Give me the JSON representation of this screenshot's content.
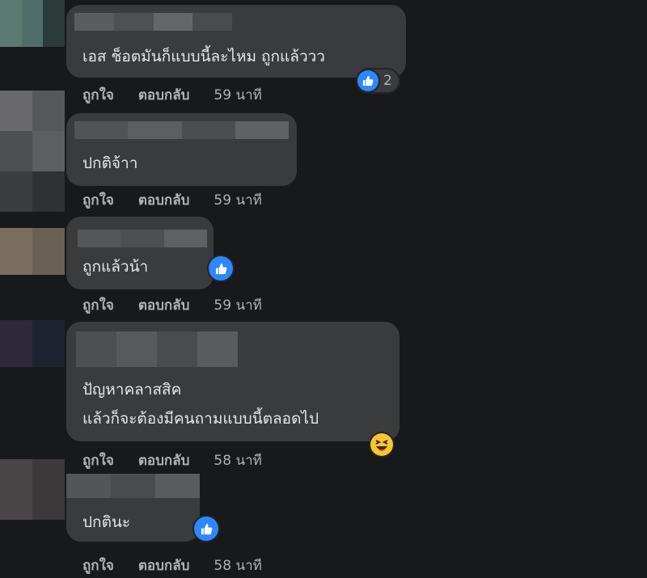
{
  "comments": [
    {
      "text_lines": [
        "เอส ช็อตมันก็แบบนี้ละไหม ถูกแล้ววว"
      ],
      "actions": {
        "like": "ถูกใจ",
        "reply": "ตอบกลับ",
        "time": "59 นาที"
      },
      "reaction": {
        "icon": "like-icon",
        "count": "2"
      }
    },
    {
      "text_lines": [
        "ปกติจ้าา"
      ],
      "actions": {
        "like": "ถูกใจ",
        "reply": "ตอบกลับ",
        "time": "59 นาที"
      },
      "reaction": null
    },
    {
      "text_lines": [
        "ถูกแล้วน้า"
      ],
      "actions": {
        "like": "ถูกใจ",
        "reply": "ตอบกลับ",
        "time": "59 นาที"
      },
      "reaction": {
        "icon": "like-icon",
        "count": ""
      }
    },
    {
      "text_lines": [
        "ปัญหาคลาสสิค",
        "แล้วก็จะต้องมีคนถามแบบนี้ตลอดไป"
      ],
      "actions": {
        "like": "ถูกใจ",
        "reply": "ตอบกลับ",
        "time": "58 นาที"
      },
      "reaction": {
        "icon": "haha-icon",
        "count": ""
      }
    },
    {
      "text_lines": [
        "ปกตินะ"
      ],
      "actions": {
        "like": "ถูกใจ",
        "reply": "ตอบกลับ",
        "time": "58 นาที"
      },
      "reaction": {
        "icon": "like-icon",
        "count": ""
      }
    }
  ],
  "colors": {
    "background": "#18191a",
    "bubble": "#3a3b3c",
    "text": "#e4e6eb",
    "secondary_text": "#b0b3b8",
    "like_blue": "#2d88ff",
    "haha_yellow": "#f7c531"
  }
}
